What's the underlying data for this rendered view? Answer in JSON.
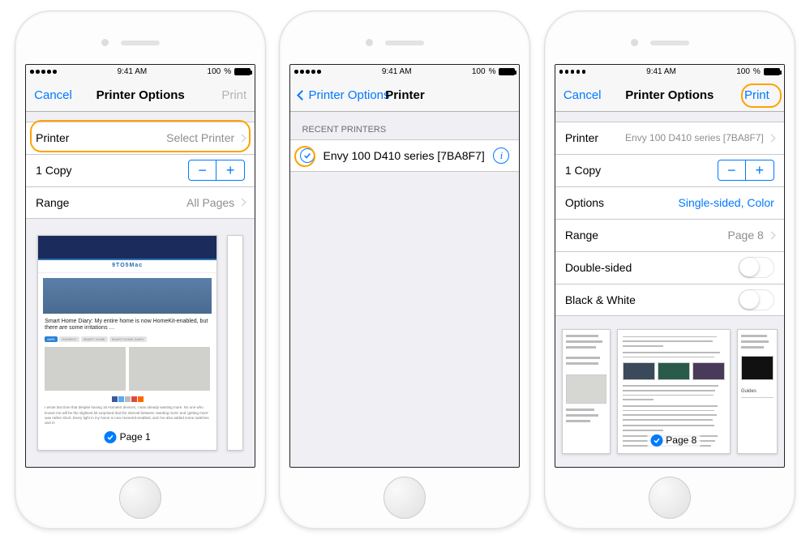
{
  "status": {
    "time": "9:41 AM",
    "battery": "100"
  },
  "screen1": {
    "cancel": "Cancel",
    "title": "Printer Options",
    "print": "Print",
    "rows": {
      "printer_label": "Printer",
      "printer_value": "Select Printer",
      "copies_label": "1 Copy",
      "range_label": "Range",
      "range_value": "All Pages"
    },
    "preview": {
      "page_label": "Page 1",
      "article_site": "9TO5Mac",
      "article_title": "Smart Home Diary: My entire home is now HomeKit-enabled, but there are some irritations …",
      "article_tags": [
        "AAPL",
        "HOMEKIT",
        "SMART HOME",
        "SMART HOME DIARY"
      ]
    }
  },
  "screen2": {
    "back": "Printer Options",
    "title": "Printer",
    "section": "RECENT PRINTERS",
    "printer_name": "Envy 100 D410 series [7BA8F7]"
  },
  "screen3": {
    "cancel": "Cancel",
    "title": "Printer Options",
    "print": "Print",
    "rows": {
      "printer_label": "Printer",
      "printer_value": "Envy 100 D410 series [7BA8F7]",
      "copies_label": "1 Copy",
      "options_label": "Options",
      "options_value": "Single-sided, Color",
      "range_label": "Range",
      "range_value": "Page 8",
      "double_label": "Double-sided",
      "bw_label": "Black & White"
    },
    "preview": {
      "page_label": "Page 8"
    }
  }
}
